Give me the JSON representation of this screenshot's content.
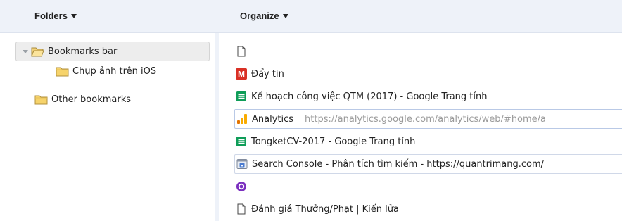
{
  "header": {
    "folders_label": "Folders",
    "organize_label": "Organize"
  },
  "tree": {
    "items": [
      {
        "label": "Bookmarks bar",
        "icon": "folder-open-icon"
      },
      {
        "label": "Chụp ảnh trên iOS",
        "icon": "folder-icon"
      },
      {
        "label": "Other bookmarks",
        "icon": "folder-icon"
      }
    ]
  },
  "list": {
    "items": [
      {
        "title": "",
        "url": "",
        "icon": "page-icon"
      },
      {
        "title": "Đẩy tin",
        "url": "",
        "icon": "gmail-m-icon"
      },
      {
        "title": "Kế hoạch công việc QTM (2017) - Google Trang tính",
        "url": "",
        "icon": "sheets-icon"
      },
      {
        "title": "Analytics",
        "url": "https://analytics.google.com/analytics/web/#home/a",
        "icon": "analytics-icon"
      },
      {
        "title": "TongketCV-2017 - Google Trang tính",
        "url": "",
        "icon": "sheets-icon"
      },
      {
        "title": "Search Console - Phân tích tìm kiếm - https://quantrimang.com/",
        "url": "",
        "icon": "search-console-icon"
      },
      {
        "title": "",
        "url": "",
        "icon": "purple-circle-icon"
      },
      {
        "title": "Đánh giá Thưởng/Phạt | Kiến lửa",
        "url": "",
        "icon": "page-icon"
      }
    ]
  },
  "colors": {
    "header_bg": "#eef2f9",
    "folder_yellow": "#f6d36b",
    "gmail_red": "#d93025",
    "sheets_green": "#0f9d58",
    "analytics_orange": "#f9ab00",
    "purple": "#7b2fbf"
  }
}
